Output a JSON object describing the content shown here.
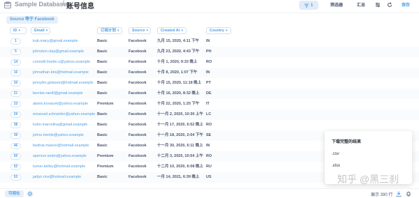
{
  "header": {
    "db_name": "Sample Database",
    "separator": "/",
    "title": "账号信息",
    "filter_count": "1",
    "filter_label": "筛选器",
    "summarize_label": "汇总",
    "save_label": "保存"
  },
  "filter_chip": "Source 等于 Facebook",
  "columns": [
    "ID",
    "Email",
    "订阅计划",
    "Source",
    "Created At",
    "Country"
  ],
  "rows": [
    {
      "id": "1",
      "email": "kub.macy@gmail.example",
      "plan": "Basic",
      "source": "Facebook",
      "created": "九月 15, 2020, 4:11 下午",
      "country": "IN"
    },
    {
      "id": "5",
      "email": "johnston.clay@gmail.example",
      "plan": "Basic",
      "source": "Facebook",
      "created": "九月 23, 2020, 4:43 下午",
      "country": "PH"
    },
    {
      "id": "14",
      "email": "connelli.lisette.u@yahoo.example",
      "plan": "Basic",
      "source": "Facebook",
      "created": "十月 1, 2020, 9:33 晚上",
      "country": "RO"
    },
    {
      "id": "16",
      "email": "johnathan.kris@hotmail.example",
      "plan": "Basic",
      "source": "Facebook",
      "created": "十月 8, 2020, 1:07 下午",
      "country": "IN"
    },
    {
      "id": "20",
      "email": "jennyfer.gislason@hotmail.example",
      "plan": "Basic",
      "source": "Facebook",
      "created": "十月 15, 2020, 11:18 晚上",
      "country": "PT"
    },
    {
      "id": "21",
      "email": "bernier.randl@gmail.example",
      "plan": "Basic",
      "source": "Facebook",
      "created": "十月 16, 2020, 8:32 晚上",
      "country": "DE"
    },
    {
      "id": "23",
      "email": "alanis.kovacek@yahoo.example",
      "plan": "Premium",
      "source": "Facebook",
      "created": "十月 22, 2020, 1:25 下午",
      "country": "IT"
    },
    {
      "id": "29",
      "email": "emanuel.schneider@yahoo.example",
      "plan": "Basic",
      "source": "Facebook",
      "created": "十一月 2, 2020, 10:30 上午",
      "country": "LC"
    },
    {
      "id": "38",
      "email": "kuhn.marcelina@gmail.example",
      "plan": "Basic",
      "source": "Facebook",
      "created": "十一月 17, 2020, 6:52 晚上",
      "country": "RO"
    },
    {
      "id": "39",
      "email": "johns.mertie@yahoo.example",
      "plan": "Basic",
      "source": "Facebook",
      "created": "十一月 18, 2020, 2:04 下午",
      "country": "SE"
    },
    {
      "id": "46",
      "email": "bednar.maeve@hotmail.example",
      "plan": "Basic",
      "source": "Facebook",
      "created": "十一月 30, 2020, 6:11 晚上",
      "country": "IN"
    },
    {
      "id": "50",
      "email": "spencer.solon@yahoo.example",
      "plan": "Premium",
      "source": "Facebook",
      "created": "十二月 3, 2020, 10:54 上午",
      "country": "RO"
    },
    {
      "id": "52",
      "email": "turner.kelley@hotmail.example",
      "plan": "Premium",
      "source": "Facebook",
      "created": "十二月 10, 2020, 6:08 晚上",
      "country": "RU"
    },
    {
      "id": "53",
      "email": "jadyn.rice@hotmail.example",
      "plan": "Basic",
      "source": "Facebook",
      "created": "一月 14, 2021, 6:39 晚上",
      "country": "US"
    }
  ],
  "download": {
    "title": "下载完整的结果",
    "options": [
      ".csv",
      ".xlsx"
    ]
  },
  "footer": {
    "visualize_label": "可视化",
    "row_count": "展示 390 行"
  },
  "watermark": "知乎 @黑三刹",
  "colors": {
    "accent": "#509ee3",
    "text": "#4c5773",
    "heading": "#2e353b"
  }
}
